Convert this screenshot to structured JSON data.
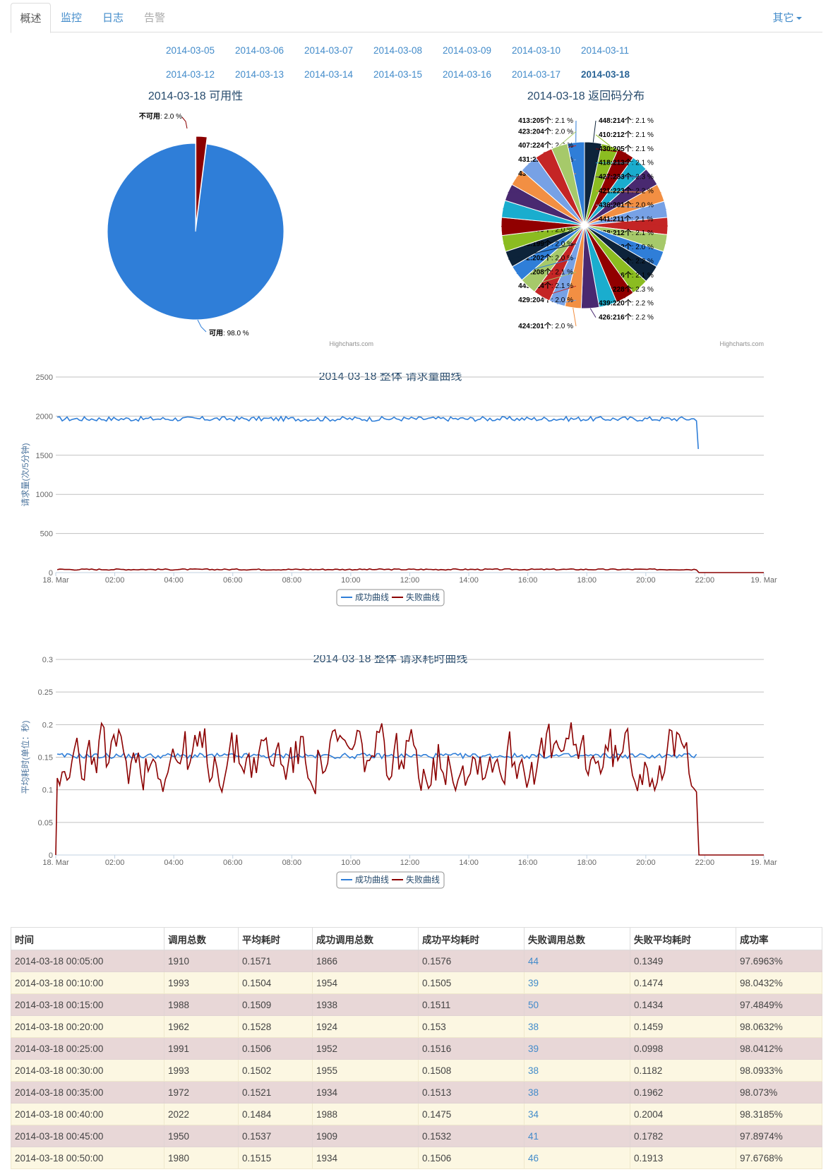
{
  "nav": {
    "tabs": [
      {
        "label": "概述",
        "state": "active"
      },
      {
        "label": "监控",
        "state": "link"
      },
      {
        "label": "日志",
        "state": "link"
      },
      {
        "label": "告警",
        "state": "disabled"
      }
    ],
    "more_label": "其它"
  },
  "dates": {
    "row1": [
      "2014-03-05",
      "2014-03-06",
      "2014-03-07",
      "2014-03-08",
      "2014-03-09",
      "2014-03-10",
      "2014-03-11"
    ],
    "row2": [
      "2014-03-12",
      "2014-03-13",
      "2014-03-14",
      "2014-03-15",
      "2014-03-16",
      "2014-03-17",
      "2014-03-18"
    ],
    "current": "2014-03-18"
  },
  "credits": "Highcharts.com",
  "colors": {
    "blue": "#2f7ed8",
    "darkred": "#8b0000",
    "grid": "#c0c0c0",
    "label": "#333333",
    "palette": [
      "#2f7ed8",
      "#0d233a",
      "#8bbc21",
      "#910000",
      "#1aadce",
      "#492970",
      "#f28f43",
      "#77a1e5",
      "#c42525",
      "#a6c96a"
    ]
  },
  "chart_data": [
    {
      "type": "pie",
      "title": "2014-03-18 可用性",
      "slices": [
        {
          "name": "不可用",
          "value": 2.0,
          "label": "2.0 %",
          "color": "#8b0000"
        },
        {
          "name": "可用",
          "value": 98.0,
          "label": "98.0 %",
          "color": "#2f7ed8"
        }
      ]
    },
    {
      "type": "pie",
      "title": "2014-03-18 返回码分布",
      "slices": [
        {
          "name": "413:205个",
          "value": 2.1
        },
        {
          "name": "448:214个",
          "value": 2.1
        },
        {
          "name": "410:212个",
          "value": 2.1
        },
        {
          "name": "430:205个",
          "value": 2.1
        },
        {
          "name": "418:213个",
          "value": 2.1
        },
        {
          "name": "427:233个",
          "value": 2.3
        },
        {
          "name": "421:223个",
          "value": 2.2
        },
        {
          "name": "436:201个",
          "value": 2.0
        },
        {
          "name": "441:211个",
          "value": 2.1
        },
        {
          "name": "438:212个",
          "value": 2.1
        },
        {
          "name": "409:202个",
          "value": 2.0
        },
        {
          "name": "428:219个",
          "value": 2.2
        },
        {
          "name": "425:206个",
          "value": 2.1
        },
        {
          "name": "416:228个",
          "value": 2.3
        },
        {
          "name": "439:220个",
          "value": 2.2
        },
        {
          "name": "426:216个",
          "value": 2.2
        },
        {
          "name": "424:201个",
          "value": 2.0
        },
        {
          "name": "429:204个",
          "value": 2.0
        },
        {
          "name": "449:214个",
          "value": 2.1
        },
        {
          "name": "405:208个",
          "value": 2.1
        },
        {
          "name": "432:202个",
          "value": 2.0
        },
        {
          "name": "443:199个",
          "value": 2.0
        },
        {
          "name": "404:199个",
          "value": 2.0
        },
        {
          "name": "406:220个",
          "value": 2.2
        },
        {
          "name": "435:209个",
          "value": 2.1
        },
        {
          "name": "437:209个",
          "value": 2.1
        },
        {
          "name": "433:206个",
          "value": 2.1
        },
        {
          "name": "431:225个",
          "value": 2.3
        },
        {
          "name": "407:224个",
          "value": 2.2
        },
        {
          "name": "423:204个",
          "value": 2.0
        }
      ]
    },
    {
      "type": "line",
      "title": "2014-03-18 整体 请求量曲线",
      "ylabel": "请求量(次/5分钟)",
      "yticks": [
        "0",
        "500",
        "1000",
        "1500",
        "2000",
        "2500"
      ],
      "ylim": [
        0,
        2500
      ],
      "xticks": [
        "18. Mar",
        "02:00",
        "04:00",
        "06:00",
        "08:00",
        "10:00",
        "12:00",
        "14:00",
        "16:00",
        "18:00",
        "20:00",
        "22:00",
        "19. Mar"
      ],
      "xlim_hours": [
        0,
        24
      ],
      "legend": [
        "成功曲线",
        "失败曲线"
      ],
      "series": [
        {
          "name": "成功曲线",
          "color": "#2f7ed8",
          "pattern": "noisy",
          "start": 0.05,
          "end": 21.75,
          "base": 1965,
          "amp": 30,
          "last_value": 1580
        },
        {
          "name": "失败曲线",
          "color": "#8b0000",
          "pattern": "noisy",
          "start": 0.05,
          "end": 21.75,
          "base": 40,
          "amp": 8,
          "after_value": 0
        }
      ]
    },
    {
      "type": "line",
      "title": "2014-03-18 整体 请求耗时曲线",
      "ylabel": "平均耗时(单位：秒)",
      "yticks": [
        "0",
        "0.05",
        "0.1",
        "0.15",
        "0.2",
        "0.25",
        "0.3"
      ],
      "ylim": [
        0,
        0.3
      ],
      "xticks": [
        "18. Mar",
        "02:00",
        "04:00",
        "06:00",
        "08:00",
        "10:00",
        "12:00",
        "14:00",
        "16:00",
        "18:00",
        "20:00",
        "22:00",
        "19. Mar"
      ],
      "xlim_hours": [
        0,
        24
      ],
      "legend": [
        "成功曲线",
        "失败曲线"
      ],
      "series": [
        {
          "name": "成功曲线",
          "color": "#2f7ed8",
          "pattern": "noisy",
          "start": 0.05,
          "end": 21.75,
          "base": 0.152,
          "amp": 0.004
        },
        {
          "name": "失败曲线",
          "color": "#8b0000",
          "pattern": "volatile",
          "start": 0.05,
          "end": 21.75,
          "base": 0.15,
          "amp": 0.05,
          "after_value": 0
        }
      ]
    }
  ],
  "table": {
    "headers": [
      "时间",
      "调用总数",
      "平均耗时",
      "成功调用总数",
      "成功平均耗时",
      "失败调用总数",
      "失败平均耗时",
      "成功率"
    ],
    "rows": [
      [
        "2014-03-18 00:05:00",
        "1910",
        "0.1571",
        "1866",
        "0.1576",
        "44",
        "0.1349",
        "97.6963%"
      ],
      [
        "2014-03-18 00:10:00",
        "1993",
        "0.1504",
        "1954",
        "0.1505",
        "39",
        "0.1474",
        "98.0432%"
      ],
      [
        "2014-03-18 00:15:00",
        "1988",
        "0.1509",
        "1938",
        "0.1511",
        "50",
        "0.1434",
        "97.4849%"
      ],
      [
        "2014-03-18 00:20:00",
        "1962",
        "0.1528",
        "1924",
        "0.153",
        "38",
        "0.1459",
        "98.0632%"
      ],
      [
        "2014-03-18 00:25:00",
        "1991",
        "0.1506",
        "1952",
        "0.1516",
        "39",
        "0.0998",
        "98.0412%"
      ],
      [
        "2014-03-18 00:30:00",
        "1993",
        "0.1502",
        "1955",
        "0.1508",
        "38",
        "0.1182",
        "98.0933%"
      ],
      [
        "2014-03-18 00:35:00",
        "1972",
        "0.1521",
        "1934",
        "0.1513",
        "38",
        "0.1962",
        "98.073%"
      ],
      [
        "2014-03-18 00:40:00",
        "2022",
        "0.1484",
        "1988",
        "0.1475",
        "34",
        "0.2004",
        "98.3185%"
      ],
      [
        "2014-03-18 00:45:00",
        "1950",
        "0.1537",
        "1909",
        "0.1532",
        "41",
        "0.1782",
        "97.8974%"
      ],
      [
        "2014-03-18 00:50:00",
        "1980",
        "0.1515",
        "1934",
        "0.1506",
        "46",
        "0.1913",
        "97.6768%"
      ]
    ]
  }
}
